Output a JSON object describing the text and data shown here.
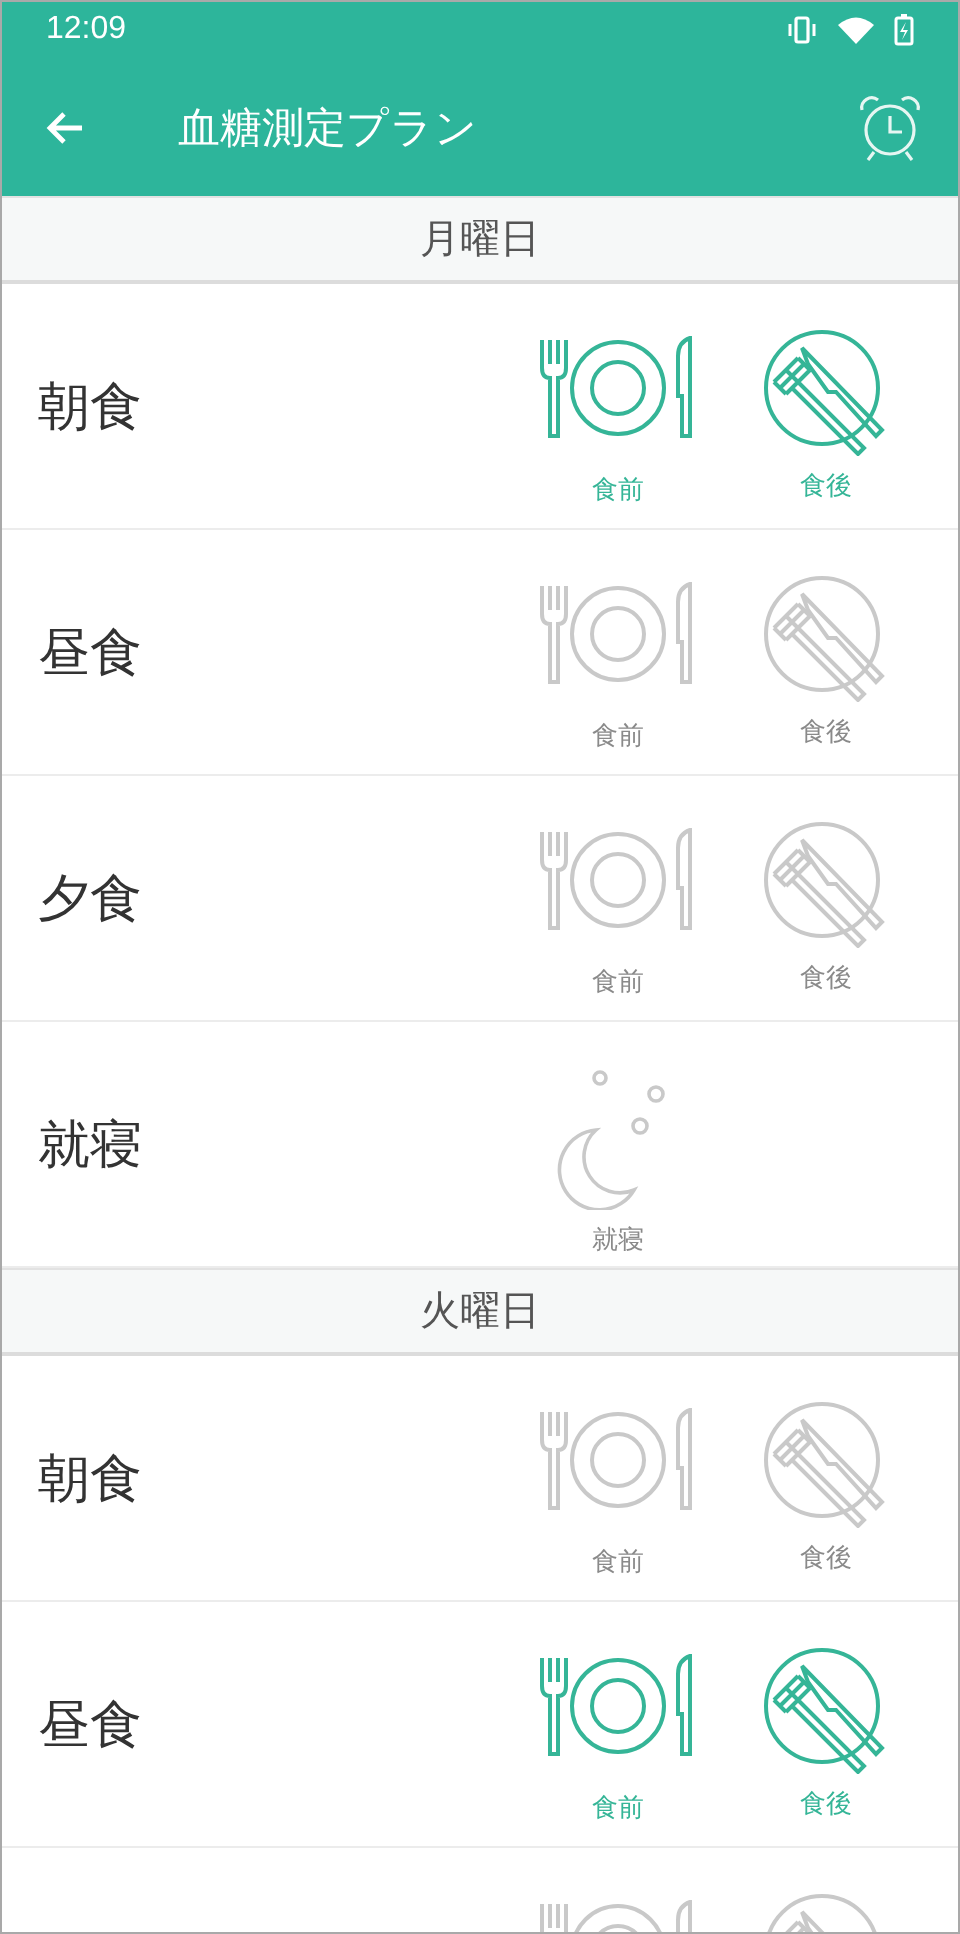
{
  "status_bar": {
    "time": "12:09"
  },
  "app_bar": {
    "title": "血糖測定プラン"
  },
  "days": [
    {
      "title": "月曜日",
      "rows": [
        {
          "label": "朝食",
          "slots": [
            {
              "kind": "before",
              "caption": "食前",
              "selected": true
            },
            {
              "kind": "after",
              "caption": "食後",
              "selected": true
            }
          ]
        },
        {
          "label": "昼食",
          "slots": [
            {
              "kind": "before",
              "caption": "食前",
              "selected": false
            },
            {
              "kind": "after",
              "caption": "食後",
              "selected": false
            }
          ]
        },
        {
          "label": "夕食",
          "slots": [
            {
              "kind": "before",
              "caption": "食前",
              "selected": false
            },
            {
              "kind": "after",
              "caption": "食後",
              "selected": false
            }
          ]
        },
        {
          "label": "就寝",
          "slots": [
            {
              "kind": "bedtime",
              "caption": "就寝",
              "selected": false
            }
          ]
        }
      ]
    },
    {
      "title": "火曜日",
      "rows": [
        {
          "label": "朝食",
          "slots": [
            {
              "kind": "before",
              "caption": "食前",
              "selected": false
            },
            {
              "kind": "after",
              "caption": "食後",
              "selected": false
            }
          ]
        },
        {
          "label": "昼食",
          "slots": [
            {
              "kind": "before",
              "caption": "食前",
              "selected": true
            },
            {
              "kind": "after",
              "caption": "食後",
              "selected": true
            }
          ]
        },
        {
          "slots": [
            {
              "kind": "before",
              "selected": false
            },
            {
              "kind": "after",
              "selected": false
            }
          ]
        }
      ]
    }
  ]
}
